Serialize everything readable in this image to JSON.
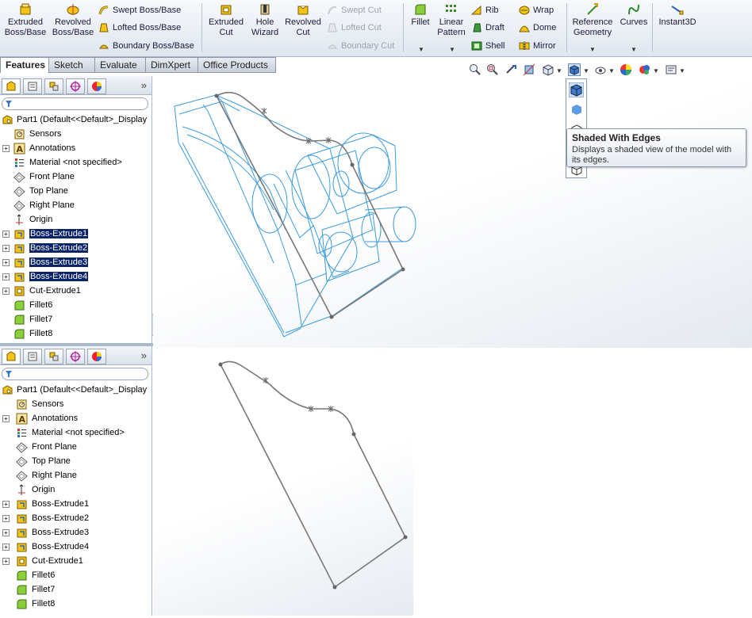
{
  "ribbon": {
    "extruded_boss": "Extruded Boss/Base",
    "revolved_boss": "Revolved Boss/Base",
    "swept_boss": "Swept Boss/Base",
    "lofted_boss": "Lofted Boss/Base",
    "boundary_boss": "Boundary Boss/Base",
    "extruded_cut": "Extruded Cut",
    "hole_wizard": "Hole Wizard",
    "revolved_cut": "Revolved Cut",
    "swept_cut": "Swept Cut",
    "lofted_cut": "Lofted Cut",
    "boundary_cut": "Boundary Cut",
    "fillet": "Fillet",
    "linear_pattern": "Linear Pattern",
    "rib": "Rib",
    "draft": "Draft",
    "shell": "Shell",
    "wrap": "Wrap",
    "dome": "Dome",
    "mirror": "Mirror",
    "reference_geometry": "Reference Geometry",
    "curves": "Curves",
    "instant3d": "Instant3D"
  },
  "tabs": [
    "Features",
    "Sketch",
    "Evaluate",
    "DimXpert",
    "Office Products"
  ],
  "tree_top": [
    {
      "label": "Part1  (Default<<Default>_Display",
      "icon": "part-icon",
      "sel": false
    },
    {
      "label": "Sensors",
      "icon": "sensors-icon",
      "sel": false
    },
    {
      "label": "Annotations",
      "icon": "annotations-icon",
      "sel": false
    },
    {
      "label": "Material <not specified>",
      "icon": "material-icon",
      "sel": false
    },
    {
      "label": "Front Plane",
      "icon": "plane-icon",
      "sel": false
    },
    {
      "label": "Top Plane",
      "icon": "plane-icon",
      "sel": false
    },
    {
      "label": "Right Plane",
      "icon": "plane-icon",
      "sel": false
    },
    {
      "label": "Origin",
      "icon": "origin-icon",
      "sel": false
    },
    {
      "label": "Boss-Extrude1",
      "icon": "extrude-icon",
      "sel": true
    },
    {
      "label": "Boss-Extrude2",
      "icon": "extrude-icon",
      "sel": true
    },
    {
      "label": "Boss-Extrude3",
      "icon": "extrude-icon",
      "sel": true
    },
    {
      "label": "Boss-Extrude4",
      "icon": "extrude-icon",
      "sel": true
    },
    {
      "label": "Cut-Extrude1",
      "icon": "cut-icon",
      "sel": false
    },
    {
      "label": "Fillet6",
      "icon": "fillet-icon",
      "sel": false
    },
    {
      "label": "Fillet7",
      "icon": "fillet-icon",
      "sel": false
    },
    {
      "label": "Fillet8",
      "icon": "fillet-icon",
      "sel": false
    }
  ],
  "tree_bottom": [
    {
      "label": "Part1  (Default<<Default>_Display",
      "icon": "part-icon",
      "sel": false
    },
    {
      "label": "Sensors",
      "icon": "sensors-icon",
      "sel": false
    },
    {
      "label": "Annotations",
      "icon": "annotations-icon",
      "sel": false
    },
    {
      "label": "Material <not specified>",
      "icon": "material-icon",
      "sel": false
    },
    {
      "label": "Front Plane",
      "icon": "plane-icon",
      "sel": false
    },
    {
      "label": "Top Plane",
      "icon": "plane-icon",
      "sel": false
    },
    {
      "label": "Right Plane",
      "icon": "plane-icon",
      "sel": false
    },
    {
      "label": "Origin",
      "icon": "origin-icon",
      "sel": false
    },
    {
      "label": "Boss-Extrude1",
      "icon": "extrude-icon",
      "sel": false
    },
    {
      "label": "Boss-Extrude2",
      "icon": "extrude-icon",
      "sel": false
    },
    {
      "label": "Boss-Extrude3",
      "icon": "extrude-icon",
      "sel": false
    },
    {
      "label": "Boss-Extrude4",
      "icon": "extrude-icon",
      "sel": false
    },
    {
      "label": "Cut-Extrude1",
      "icon": "cut-icon",
      "sel": false
    },
    {
      "label": "Fillet6",
      "icon": "fillet-icon",
      "sel": false
    },
    {
      "label": "Fillet7",
      "icon": "fillet-icon",
      "sel": false
    },
    {
      "label": "Fillet8",
      "icon": "fillet-icon",
      "sel": false
    }
  ],
  "tooltip": {
    "title": "Shaded With Edges",
    "desc": "Displays a shaded view of the model with its edges."
  },
  "colors": {
    "selection": "#0a246a",
    "wireframe": "#3b9be0",
    "sketch": "#777777",
    "ribbon_text": "#1a1a3a"
  }
}
